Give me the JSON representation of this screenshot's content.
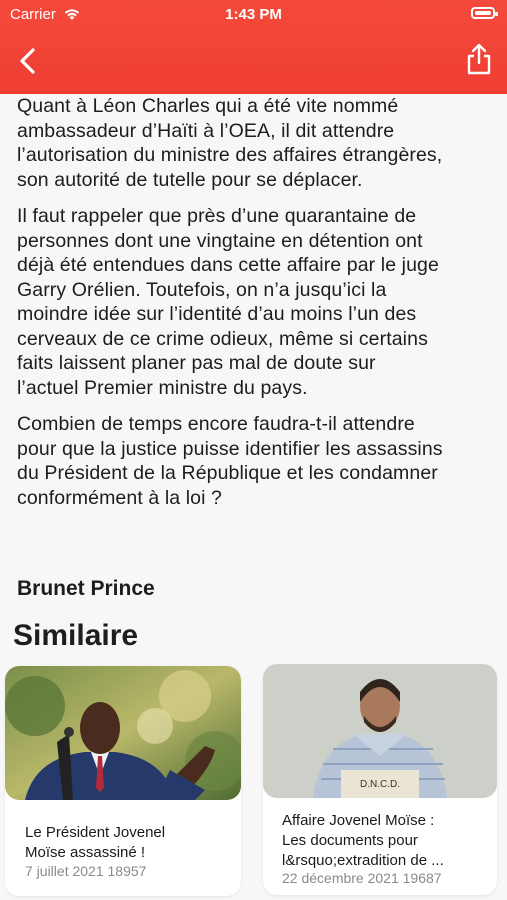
{
  "status_bar": {
    "carrier": "Carrier",
    "time": "1:43 PM"
  },
  "nav": {
    "back_icon": "chevron-left-icon",
    "share_icon": "share-icon",
    "accent": "#f04236"
  },
  "article": {
    "paragraphs": [
      "Quant à Léon Charles qui a été vite nommé\nambassadeur d’Haïti à l’OEA, il dit attendre\nl’autorisation du ministre des affaires étrangères,\nson autorité de tutelle pour se déplacer.",
      "Il faut rappeler que près d’une quarantaine de\npersonnes dont une vingtaine en détention ont\ndéjà été entendues dans cette affaire par le juge\nGarry Orélien. Toutefois, on n’a  jusqu’ici la\nmoindre idée sur l’identité d’au moins l’un des\ncerveaux de ce crime odieux, même si certains\nfaits  laissent planer pas mal de doute sur\nl’actuel Premier ministre du pays.",
      "Combien de temps encore faudra-t-il attendre\npour que la justice puisse identifier les assassins\ndu Président de la République et les condamner\nconformément à la loi ?"
    ],
    "author": "Brunet Prince"
  },
  "similar": {
    "heading": "Similaire",
    "cards": [
      {
        "title": "Le Président Jovenel\nMoïse assassiné !",
        "meta": "7 juillet 2021 18957"
      },
      {
        "title": "Affaire Jovenel Moïse :\nLes documents pour\nl&rsquo;extradition de ...",
        "meta": "22 décembre 2021 19687",
        "badge": "D.N.C.D."
      }
    ]
  }
}
